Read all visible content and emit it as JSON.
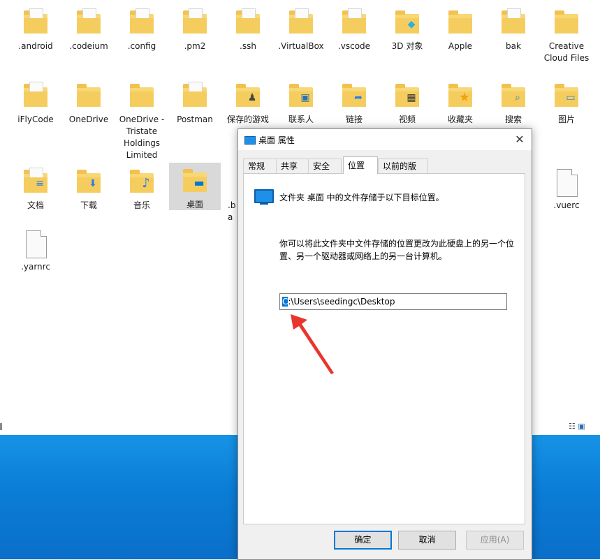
{
  "files": [
    {
      "label": ".android",
      "type": "folder"
    },
    {
      "label": ".codeium",
      "type": "folder"
    },
    {
      "label": ".config",
      "type": "folder"
    },
    {
      "label": ".pm2",
      "type": "folder"
    },
    {
      "label": ".ssh",
      "type": "folder"
    },
    {
      "label": ".VirtualBox",
      "type": "folder"
    },
    {
      "label": ".vscode",
      "type": "folder"
    },
    {
      "label": "3D 对象",
      "type": "folder",
      "badge": "cube-icon"
    },
    {
      "label": "Apple",
      "type": "folder"
    },
    {
      "label": "bak",
      "type": "folder"
    },
    {
      "label": "Creative Cloud Files",
      "type": "folder"
    },
    {
      "label": "iFlyCode",
      "type": "folder"
    },
    {
      "label": "OneDrive",
      "type": "folder"
    },
    {
      "label": "OneDrive - Tristate Holdings Limited",
      "type": "folder"
    },
    {
      "label": "Postman",
      "type": "folder"
    },
    {
      "label": "保存的游戏",
      "type": "folder",
      "badge": "chess-piece-icon"
    },
    {
      "label": "联系人",
      "type": "folder",
      "badge": "contact-card-icon"
    },
    {
      "label": "链接",
      "type": "folder",
      "badge": "link-arrow-icon"
    },
    {
      "label": "视频",
      "type": "folder",
      "badge": "film-icon"
    },
    {
      "label": "收藏夹",
      "type": "folder",
      "badge": "star-icon"
    },
    {
      "label": "搜索",
      "type": "folder",
      "badge": "magnifier-icon"
    },
    {
      "label": "图片",
      "type": "folder",
      "badge": "picture-icon"
    },
    {
      "label": "文档",
      "type": "folder",
      "badge": "document-icon"
    },
    {
      "label": "下载",
      "type": "folder",
      "badge": "download-arrow-icon"
    },
    {
      "label": "音乐",
      "type": "folder",
      "badge": "music-note-icon"
    },
    {
      "label": "桌面",
      "type": "folder",
      "badge": "desktop-icon"
    },
    {
      "label": ".ba",
      "type": "file"
    },
    {
      "label": ".vuerc",
      "type": "file"
    },
    {
      "label": ".yarnrc",
      "type": "file"
    }
  ],
  "dialog": {
    "title": "桌面 属性",
    "close": "✕",
    "tabs": [
      "常规",
      "共享",
      "安全",
      "位置",
      "以前的版本"
    ],
    "active_tab": "位置",
    "line1": "文件夹 桌面 中的文件存储于以下目标位置。",
    "description": "你可以将此文件夹中文件存储的位置更改为此硬盘上的另一个位置、另一个驱动器或网络上的另一台计算机。",
    "path_selected": "C",
    "path_rest": ":\\Users\\seedingc\\Desktop",
    "buttons": {
      "ok": "确定",
      "cancel": "取消",
      "apply": "应用(A)"
    }
  },
  "colors": {
    "accent": "#0078d7",
    "arrow": "#e8362d",
    "folder": "#f8d775",
    "wallpaper": "#0b7dd6"
  }
}
